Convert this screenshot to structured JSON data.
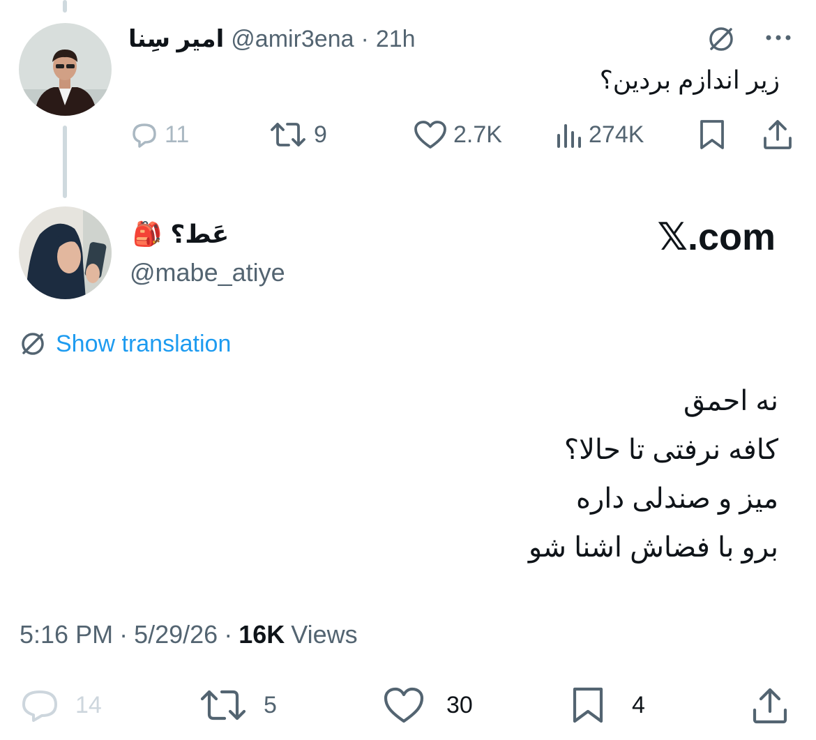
{
  "parent_tweet": {
    "author_name": "امیر سِنا",
    "handle": "@amir3ena",
    "separator": "·",
    "time": "21h",
    "text": "زیر اندازم بردین؟",
    "stats": {
      "replies": "11",
      "retweets": "9",
      "likes": "2.7K",
      "views": "274K"
    },
    "icons": [
      "translate-icon",
      "more-icon",
      "reply-icon",
      "retweet-icon",
      "like-icon",
      "views-icon",
      "bookmark-icon",
      "share-icon"
    ]
  },
  "main_tweet": {
    "author_name": "عَط؟",
    "author_emoji": "🎒",
    "handle": "@mabe_atiye",
    "watermark": "𝕏.com",
    "show_translation": "Show translation",
    "text_lines": [
      "نه احمق",
      "کافه نرفتی تا حالا؟",
      "میز و صندلی داره",
      "برو با فضاش اشنا شو"
    ],
    "meta": {
      "time": "5:16 PM",
      "sep1": "·",
      "date": "5/29/26",
      "sep2": "·",
      "views_count": "16K",
      "views_label": "Views"
    },
    "stats": {
      "replies": "14",
      "retweets": "5",
      "likes": "30",
      "bookmarks": "4"
    }
  },
  "colors": {
    "text": "#0f1419",
    "secondary": "#536471",
    "link": "#1d9bf0",
    "thread_line": "#cfd9de",
    "disabled": "#aab8c2"
  }
}
